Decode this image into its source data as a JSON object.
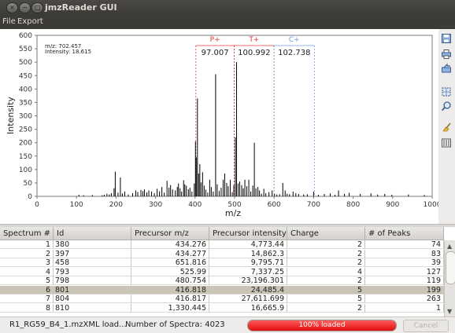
{
  "window": {
    "title": "jmzReader GUI",
    "controls": [
      "×",
      "−",
      "□"
    ]
  },
  "menu": {
    "items": [
      "File",
      "Export"
    ]
  },
  "chart_data": {
    "type": "bar",
    "xlabel": "m/z",
    "ylabel": "Intensity",
    "xlim": [
      0,
      1000
    ],
    "ylim": [
      0,
      600
    ],
    "xticks": [
      0,
      100,
      200,
      300,
      400,
      500,
      600,
      700,
      800,
      900,
      1000
    ],
    "yticks": [
      0,
      50,
      100,
      150,
      200,
      250,
      300,
      350,
      400,
      450,
      500,
      550,
      600
    ],
    "info_lines": [
      "m/z: 702.457",
      "Intensity: 18.615"
    ],
    "markers": [
      {
        "name": "P+",
        "mz": 402,
        "label": "97.007",
        "color": "#e23a3a"
      },
      {
        "name": "T+",
        "mz": 499,
        "label": "100.992",
        "color": "#e23a3a"
      },
      {
        "name": "C+",
        "mz": 600,
        "label": "102.738",
        "color": "#6e9ee0"
      }
    ],
    "marker_end": 702,
    "peaks": [
      [
        106,
        6
      ],
      [
        118,
        4
      ],
      [
        140,
        5
      ],
      [
        165,
        4
      ],
      [
        170,
        6
      ],
      [
        177,
        10
      ],
      [
        183,
        7
      ],
      [
        188,
        12
      ],
      [
        195,
        30
      ],
      [
        198,
        92
      ],
      [
        205,
        14
      ],
      [
        211,
        70
      ],
      [
        216,
        11
      ],
      [
        222,
        18
      ],
      [
        231,
        7
      ],
      [
        242,
        12
      ],
      [
        250,
        22
      ],
      [
        255,
        16
      ],
      [
        263,
        24
      ],
      [
        268,
        20
      ],
      [
        272,
        26
      ],
      [
        278,
        15
      ],
      [
        283,
        22
      ],
      [
        290,
        18
      ],
      [
        297,
        12
      ],
      [
        304,
        28
      ],
      [
        310,
        19
      ],
      [
        316,
        35
      ],
      [
        322,
        14
      ],
      [
        329,
        58
      ],
      [
        334,
        32
      ],
      [
        338,
        42
      ],
      [
        343,
        26
      ],
      [
        350,
        22
      ],
      [
        355,
        35
      ],
      [
        358,
        48
      ],
      [
        362,
        30
      ],
      [
        366,
        18
      ],
      [
        371,
        60
      ],
      [
        374,
        45
      ],
      [
        378,
        40
      ],
      [
        383,
        26
      ],
      [
        387,
        32
      ],
      [
        392,
        18
      ],
      [
        398,
        48
      ],
      [
        401,
        205
      ],
      [
        403,
        145
      ],
      [
        406,
        365
      ],
      [
        409,
        85
      ],
      [
        412,
        120
      ],
      [
        415,
        52
      ],
      [
        419,
        90
      ],
      [
        423,
        40
      ],
      [
        427,
        25
      ],
      [
        432,
        14
      ],
      [
        437,
        62
      ],
      [
        441,
        35
      ],
      [
        446,
        18
      ],
      [
        452,
        455
      ],
      [
        456,
        45
      ],
      [
        461,
        20
      ],
      [
        466,
        32
      ],
      [
        471,
        62
      ],
      [
        475,
        85
      ],
      [
        480,
        50
      ],
      [
        484,
        38
      ],
      [
        489,
        62
      ],
      [
        494,
        16
      ],
      [
        498,
        42
      ],
      [
        502,
        220
      ],
      [
        505,
        500
      ],
      [
        509,
        48
      ],
      [
        513,
        55
      ],
      [
        518,
        42
      ],
      [
        522,
        30
      ],
      [
        526,
        62
      ],
      [
        531,
        38
      ],
      [
        536,
        62
      ],
      [
        541,
        18
      ],
      [
        546,
        40
      ],
      [
        550,
        200
      ],
      [
        554,
        30
      ],
      [
        559,
        35
      ],
      [
        563,
        22
      ],
      [
        568,
        10
      ],
      [
        574,
        28
      ],
      [
        579,
        12
      ],
      [
        587,
        16
      ],
      [
        595,
        22
      ],
      [
        601,
        9
      ],
      [
        607,
        7
      ],
      [
        614,
        8
      ],
      [
        622,
        50
      ],
      [
        628,
        22
      ],
      [
        633,
        10
      ],
      [
        639,
        8
      ],
      [
        648,
        18
      ],
      [
        655,
        12
      ],
      [
        662,
        9
      ],
      [
        675,
        7
      ],
      [
        684,
        8
      ],
      [
        700,
        18
      ],
      [
        712,
        6
      ],
      [
        727,
        9
      ],
      [
        742,
        11
      ],
      [
        754,
        6
      ],
      [
        763,
        22
      ],
      [
        778,
        9
      ],
      [
        790,
        13
      ],
      [
        818,
        9
      ],
      [
        845,
        11
      ],
      [
        862,
        7
      ],
      [
        880,
        9
      ],
      [
        898,
        6
      ],
      [
        940,
        7
      ],
      [
        980,
        5
      ]
    ]
  },
  "table": {
    "columns": [
      "Spectrum #",
      "Id",
      "Precursor m/z",
      "Precursor intensity",
      "Charge",
      "# of Peaks"
    ],
    "rows": [
      [
        "1",
        "380",
        "434.276",
        "4,773.44",
        "2",
        "74"
      ],
      [
        "2",
        "397",
        "434.277",
        "14,862.3",
        "2",
        "83"
      ],
      [
        "3",
        "458",
        "651.816",
        "9,795.71",
        "2",
        "39"
      ],
      [
        "4",
        "793",
        "525.99",
        "7,337.25",
        "4",
        "127"
      ],
      [
        "5",
        "798",
        "480.754",
        "23,196.301",
        "2",
        "119"
      ],
      [
        "6",
        "801",
        "416.818",
        "24,485.4",
        "5",
        "199"
      ],
      [
        "7",
        "804",
        "416.817",
        "27,611.699",
        "5",
        "263"
      ],
      [
        "8",
        "810",
        "1,330.445",
        "16,665.9",
        "2",
        "1"
      ]
    ],
    "selected_row": 5
  },
  "status": {
    "file_text": "R1_RG59_B4_1.mzXML load...",
    "spectra_text": "Number of Spectra: 4023",
    "progress_label": "100% loaded",
    "progress_fraction": 1.0,
    "cancel_label": "Cancel"
  }
}
